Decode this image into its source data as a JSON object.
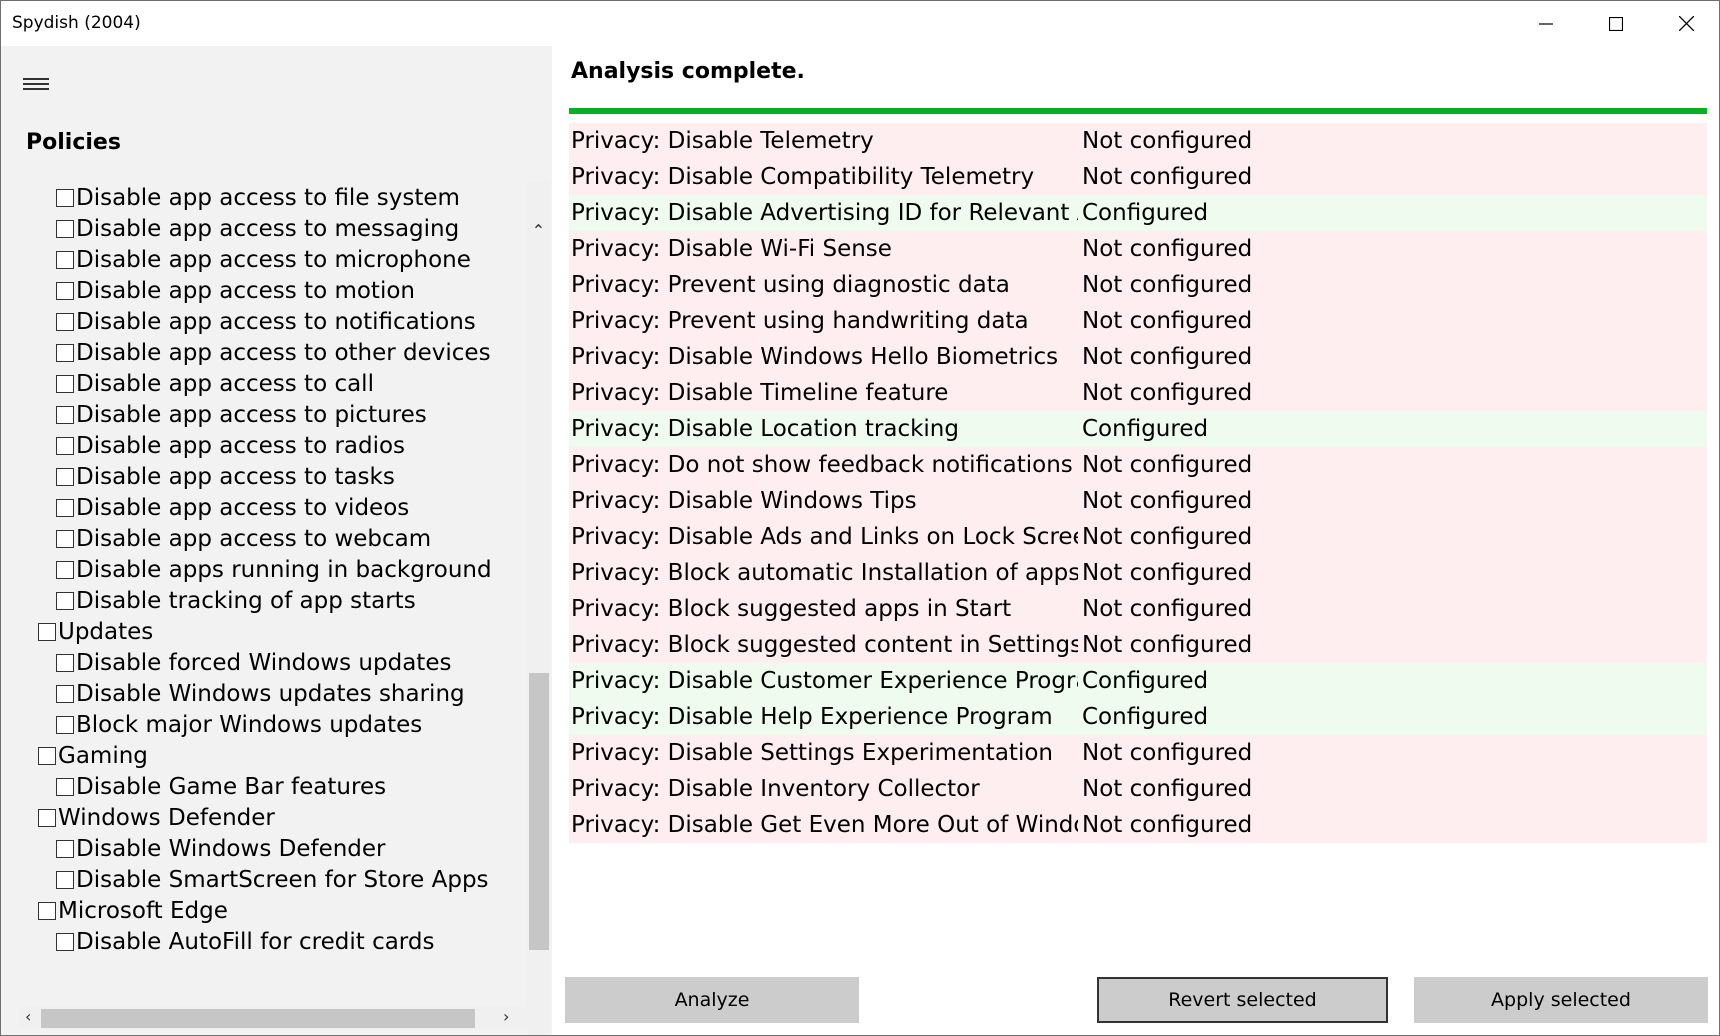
{
  "window": {
    "title": "Spydish (2004)"
  },
  "titlebar": {
    "minimize_icon": "minimize-icon",
    "maximize_icon": "maximize-icon",
    "close_icon": "close-icon"
  },
  "sidebar": {
    "heading": "Policies",
    "items": [
      {
        "label": "Disable app access to file system",
        "level": 2,
        "checked": false
      },
      {
        "label": "Disable app access to messaging",
        "level": 2,
        "checked": false
      },
      {
        "label": "Disable app access to microphone",
        "level": 2,
        "checked": false
      },
      {
        "label": "Disable app access to motion",
        "level": 2,
        "checked": false
      },
      {
        "label": "Disable app access to notifications",
        "level": 2,
        "checked": false
      },
      {
        "label": "Disable app access to other devices",
        "level": 2,
        "checked": false
      },
      {
        "label": "Disable app access to call",
        "level": 2,
        "checked": false
      },
      {
        "label": "Disable app access to pictures",
        "level": 2,
        "checked": false
      },
      {
        "label": "Disable app access to radios",
        "level": 2,
        "checked": false
      },
      {
        "label": "Disable app access to tasks",
        "level": 2,
        "checked": false
      },
      {
        "label": "Disable app access to videos",
        "level": 2,
        "checked": false
      },
      {
        "label": "Disable app access to webcam",
        "level": 2,
        "checked": false
      },
      {
        "label": "Disable apps running in background",
        "level": 2,
        "checked": false
      },
      {
        "label": "Disable tracking of app starts",
        "level": 2,
        "checked": false
      },
      {
        "label": "Updates",
        "level": 1,
        "checked": false
      },
      {
        "label": "Disable forced Windows updates",
        "level": 2,
        "checked": false
      },
      {
        "label": "Disable Windows updates sharing",
        "level": 2,
        "checked": false
      },
      {
        "label": "Block major Windows updates",
        "level": 2,
        "checked": false
      },
      {
        "label": "Gaming",
        "level": 1,
        "checked": false
      },
      {
        "label": "Disable Game Bar features",
        "level": 2,
        "checked": false
      },
      {
        "label": "Windows Defender",
        "level": 1,
        "checked": false
      },
      {
        "label": "Disable Windows Defender",
        "level": 2,
        "checked": false
      },
      {
        "label": "Disable SmartScreen for Store Apps",
        "level": 2,
        "checked": false
      },
      {
        "label": "Microsoft Edge",
        "level": 1,
        "checked": false
      },
      {
        "label": "Disable AutoFill for credit cards",
        "level": 2,
        "checked": false
      }
    ]
  },
  "main": {
    "status": "Analysis complete.",
    "progress": 1.0,
    "colors": {
      "progress": "#06b025",
      "not_configured": "#ffeef0",
      "configured": "#eefbee"
    },
    "results": [
      {
        "name": "Privacy: Disable Telemetry",
        "state": "Not configured"
      },
      {
        "name": "Privacy: Disable Compatibility Telemetry",
        "state": "Not configured"
      },
      {
        "name": "Privacy: Disable Advertising ID for Relevant Ads",
        "state": "Configured"
      },
      {
        "name": "Privacy: Disable Wi-Fi Sense",
        "state": "Not configured"
      },
      {
        "name": "Privacy: Prevent using diagnostic data",
        "state": "Not configured"
      },
      {
        "name": "Privacy: Prevent using handwriting data",
        "state": "Not configured"
      },
      {
        "name": "Privacy: Disable Windows Hello Biometrics",
        "state": "Not configured"
      },
      {
        "name": "Privacy: Disable Timeline feature",
        "state": "Not configured"
      },
      {
        "name": "Privacy: Disable Location tracking",
        "state": "Configured"
      },
      {
        "name": "Privacy: Do not show feedback notifications",
        "state": "Not configured"
      },
      {
        "name": "Privacy: Disable Windows Tips",
        "state": "Not configured"
      },
      {
        "name": "Privacy: Disable Ads and Links on Lock Screen",
        "state": "Not configured"
      },
      {
        "name": "Privacy: Block automatic Installation of apps",
        "state": "Not configured"
      },
      {
        "name": "Privacy: Block suggested apps in Start",
        "state": "Not configured"
      },
      {
        "name": "Privacy: Block suggested content in Settings app",
        "state": "Not configured"
      },
      {
        "name": "Privacy: Disable Customer Experience Program",
        "state": "Configured"
      },
      {
        "name": "Privacy: Disable Help Experience Program",
        "state": "Configured"
      },
      {
        "name": "Privacy: Disable Settings Experimentation",
        "state": "Not configured"
      },
      {
        "name": "Privacy: Disable Inventory Collector",
        "state": "Not configured"
      },
      {
        "name": "Privacy: Disable Get Even More Out of Windows",
        "state": "Not configured"
      }
    ]
  },
  "buttons": {
    "analyze": "Analyze",
    "revert": "Revert selected",
    "apply": "Apply selected"
  }
}
